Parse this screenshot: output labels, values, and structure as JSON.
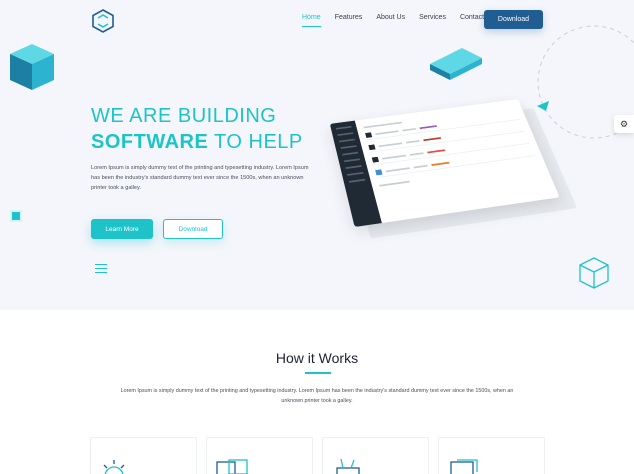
{
  "nav": {
    "items": [
      {
        "label": "Home",
        "active": true
      },
      {
        "label": "Features",
        "active": false
      },
      {
        "label": "About Us",
        "active": false
      },
      {
        "label": "Services",
        "active": false
      },
      {
        "label": "Contact",
        "active": false
      }
    ],
    "download_label": "Download"
  },
  "hero": {
    "headline_line1": "WE ARE BUILDING",
    "headline_bold": "SOFTWARE",
    "headline_rest": " TO HELP",
    "body": "Lorem Ipsum is simply dummy text of the printing and typesetting industry. Lorem Ipsum has been the industry's standard dummy text ever since the 1500s, when an unknown printer took a galley.",
    "learn_more_label": "Learn More",
    "download_label": "Download"
  },
  "how_it_works": {
    "title": "How it Works",
    "subtitle": "Lorem Ipsum is simply dummy text of the printing and typesetting industry. Lorem Ipsum has been the industry's standard dummy text ever since the 1500s, when an unknown printer took a galley."
  },
  "cards": [
    {
      "icon": "sun-icon"
    },
    {
      "icon": "browser-windows-icon"
    },
    {
      "icon": "design-tools-icon"
    },
    {
      "icon": "layers-icon"
    }
  ],
  "colors": {
    "accent": "#1ec3c9",
    "primary_button": "#1f5d93",
    "hero_background": "#f4f6fb"
  }
}
